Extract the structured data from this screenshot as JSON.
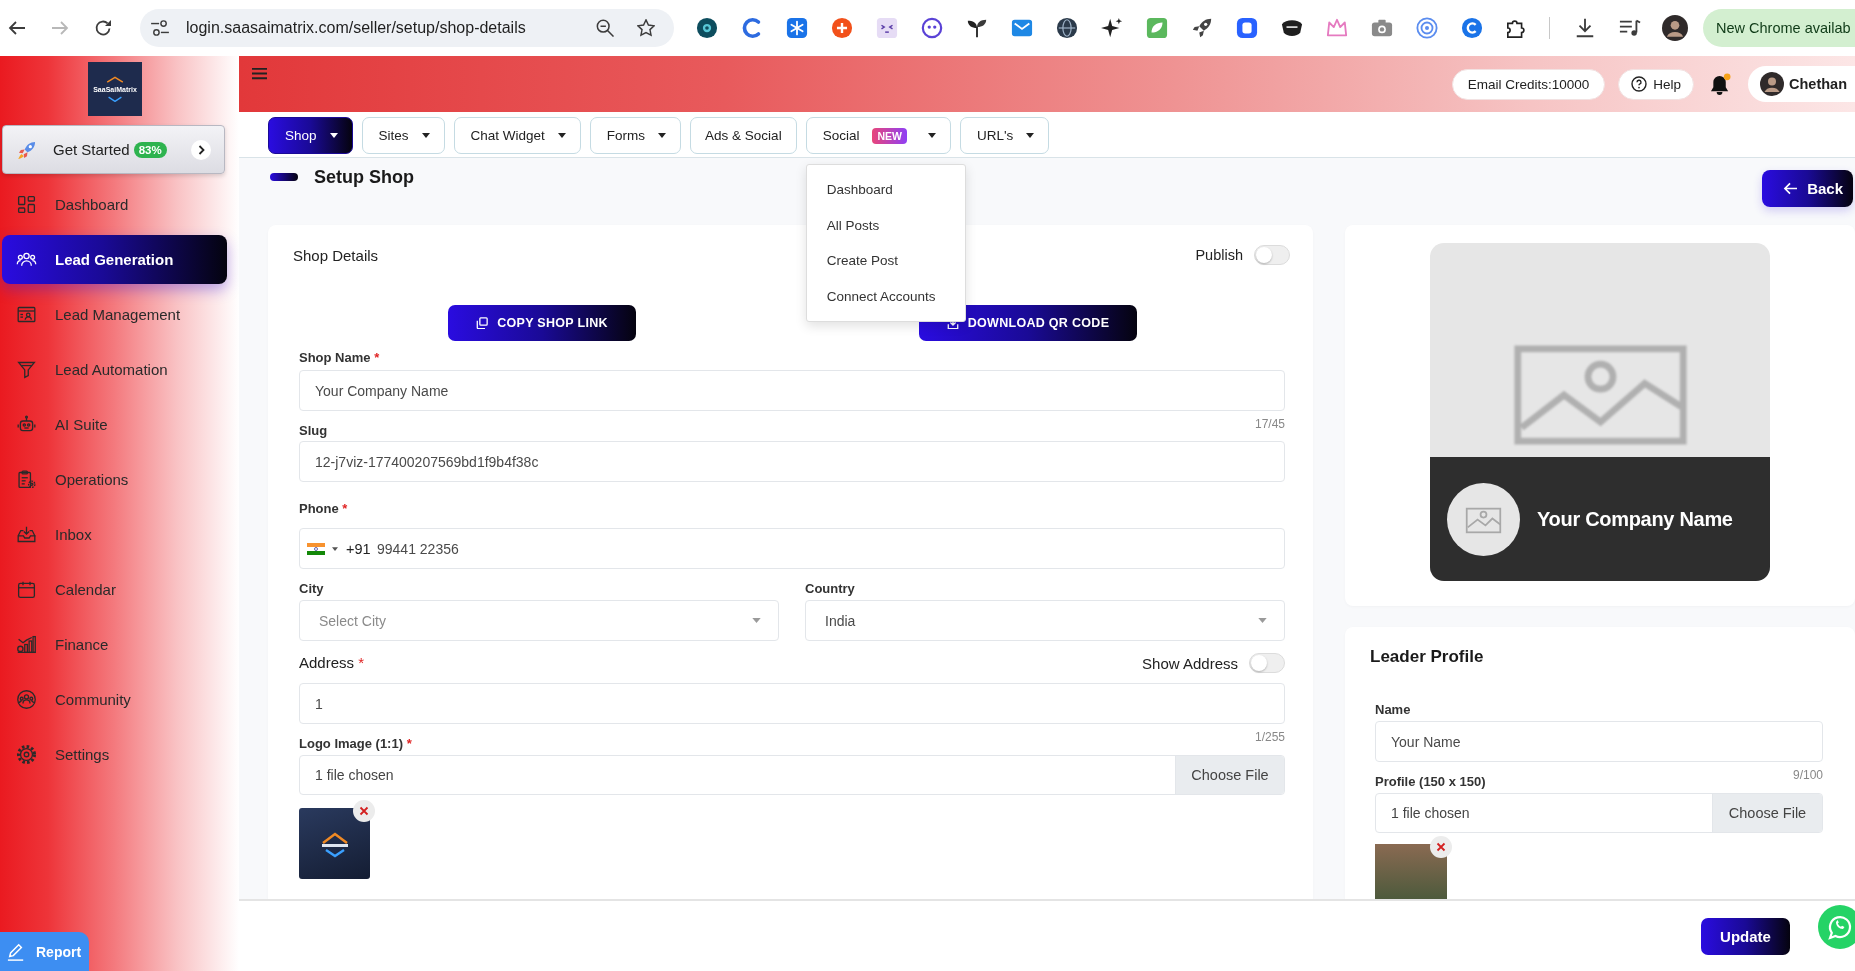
{
  "browser": {
    "url": "login.saasaimatrix.com/seller/setup/shop-details",
    "forward_disabled": true,
    "update_label": "New Chrome availab"
  },
  "sidebar": {
    "logo_text": "SaaSaiMatrix",
    "get_started": {
      "label": "Get Started",
      "progress": "83%"
    },
    "items": [
      {
        "label": "Dashboard",
        "selected": false
      },
      {
        "label": "Lead Generation",
        "selected": true
      },
      {
        "label": "Lead Management",
        "selected": false
      },
      {
        "label": "Lead Automation",
        "selected": false
      },
      {
        "label": "AI Suite",
        "selected": false
      },
      {
        "label": "Operations",
        "selected": false
      },
      {
        "label": "Inbox",
        "selected": false
      },
      {
        "label": "Calendar",
        "selected": false
      },
      {
        "label": "Finance",
        "selected": false
      },
      {
        "label": "Community",
        "selected": false
      },
      {
        "label": "Settings",
        "selected": false
      }
    ],
    "report": "Report"
  },
  "header": {
    "email_credits": "Email Credits:10000",
    "help": "Help",
    "unread_notifications": true,
    "user_name": "Chethan"
  },
  "tabs": [
    {
      "label": "Shop",
      "selected": true,
      "dropdown": true
    },
    {
      "label": "Sites",
      "selected": false,
      "dropdown": true
    },
    {
      "label": "Chat Widget",
      "selected": false,
      "dropdown": true
    },
    {
      "label": "Forms",
      "selected": false,
      "dropdown": true
    },
    {
      "label": "Ads & Social",
      "selected": false,
      "dropdown": false
    },
    {
      "label": "Social",
      "selected": false,
      "dropdown": true,
      "badge": "NEW",
      "menu": [
        "Dashboard",
        "All Posts",
        "Create Post",
        "Connect Accounts"
      ]
    },
    {
      "label": "URL's",
      "selected": false,
      "dropdown": true
    }
  ],
  "page": {
    "title": "Setup Shop",
    "back": "Back"
  },
  "shop_details": {
    "title": "Shop Details",
    "publish": {
      "label": "Publish",
      "on": false
    },
    "actions": [
      "COPY SHOP LINK",
      "DOWNLOAD QR CODE"
    ],
    "shop_name": {
      "label": "Shop Name",
      "mark": "*",
      "value": "Your Company Name",
      "counter": "17/45"
    },
    "slug": {
      "label": "Slug",
      "value": "12-j7viz-177400207569bd1f9b4f38c"
    },
    "phone": {
      "label": "Phone",
      "mark": "*",
      "dial_code": "+91",
      "value": "99441 22356"
    },
    "city": {
      "label": "City",
      "placeholder": "Select City"
    },
    "country": {
      "label": "Country",
      "value": "India"
    },
    "address": {
      "label": "Address",
      "mark": "*",
      "value": "1",
      "counter": "1/255",
      "show_address": {
        "label": "Show Address",
        "on": false
      }
    },
    "logo": {
      "label": "Logo Image (1:1)",
      "mark": "*",
      "file_status": "1 file chosen",
      "button": "Choose File"
    }
  },
  "preview": {
    "company_name": "Your Company Name"
  },
  "leader_profile": {
    "title": "Leader Profile",
    "name": {
      "label": "Name",
      "value": "Your Name",
      "counter": "9/100"
    },
    "photo": {
      "label": "Profile (150 x 150)",
      "file_status": "1 file chosen",
      "button": "Choose File"
    }
  },
  "footer": {
    "update": "Update"
  }
}
